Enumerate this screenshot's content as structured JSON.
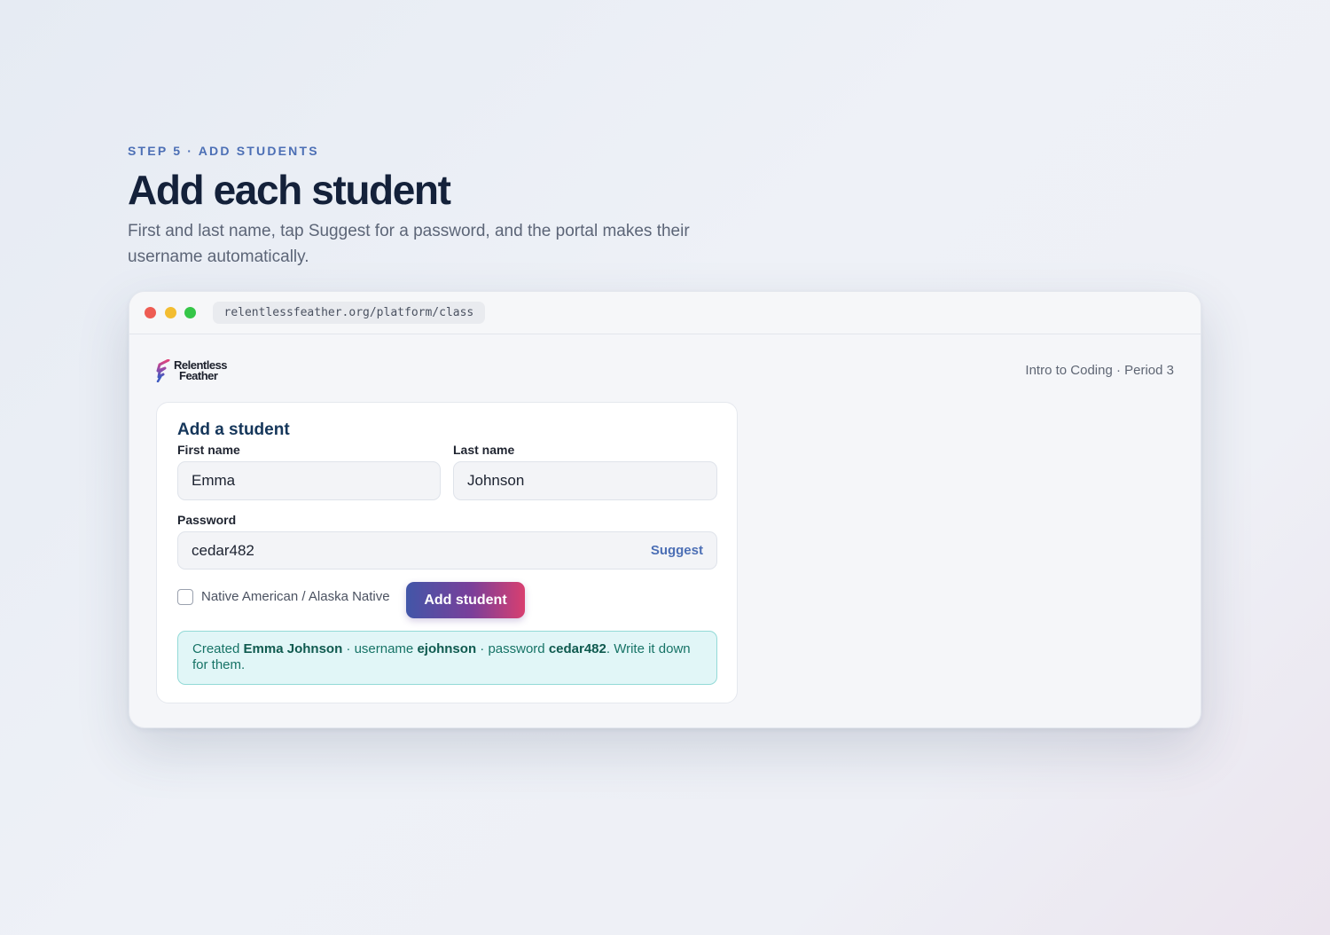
{
  "intro": {
    "eyebrow": "STEP 5 · ADD STUDENTS",
    "headline": "Add each student",
    "subtext": "First and last name, tap Suggest for a password, and the portal makes their username automatically."
  },
  "browser": {
    "url": "relentlessfeather.org/platform/class"
  },
  "app": {
    "logo": {
      "line1": "Relentless",
      "line2": "Feather"
    },
    "class_name": "Intro to Coding · Period 3"
  },
  "form": {
    "title": "Add a student",
    "first_name": {
      "label": "First name",
      "value": "Emma"
    },
    "last_name": {
      "label": "Last name",
      "value": "Johnson"
    },
    "password": {
      "label": "Password",
      "value": "cedar482",
      "suggest_label": "Suggest"
    },
    "checkbox": {
      "label": "Native American / Alaska Native",
      "checked": false
    },
    "submit_label": "Add student"
  },
  "notice": {
    "prefix": "Created ",
    "name": "Emma Johnson",
    "mid1": " · username ",
    "username": "ejohnson",
    "mid2": " · password ",
    "password": "cedar482",
    "suffix": ". Write it down for them."
  },
  "colors": {
    "accent": "#4c6fb5",
    "headline": "#14213a",
    "card_title": "#15365a",
    "button_gradient": [
      "#4256a8",
      "#7a3f9a",
      "#d83f70"
    ],
    "notice_bg": "#e1f6f7",
    "notice_text": "#167366"
  }
}
